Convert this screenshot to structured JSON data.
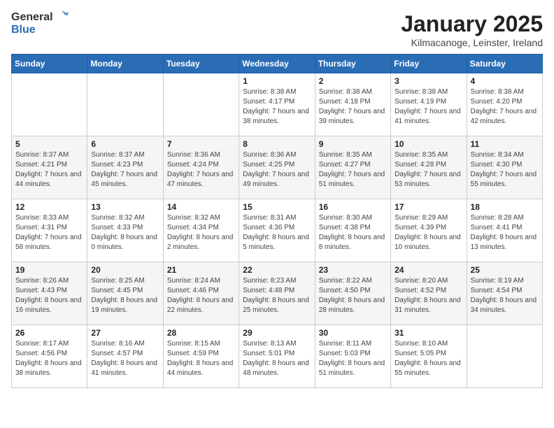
{
  "logo": {
    "general": "General",
    "blue": "Blue"
  },
  "title": "January 2025",
  "location": "Kilmacanoge, Leinster, Ireland",
  "days_of_week": [
    "Sunday",
    "Monday",
    "Tuesday",
    "Wednesday",
    "Thursday",
    "Friday",
    "Saturday"
  ],
  "weeks": [
    [
      {
        "day": "",
        "sunrise": "",
        "sunset": "",
        "daylight": ""
      },
      {
        "day": "",
        "sunrise": "",
        "sunset": "",
        "daylight": ""
      },
      {
        "day": "",
        "sunrise": "",
        "sunset": "",
        "daylight": ""
      },
      {
        "day": "1",
        "sunrise": "Sunrise: 8:38 AM",
        "sunset": "Sunset: 4:17 PM",
        "daylight": "Daylight: 7 hours and 38 minutes."
      },
      {
        "day": "2",
        "sunrise": "Sunrise: 8:38 AM",
        "sunset": "Sunset: 4:18 PM",
        "daylight": "Daylight: 7 hours and 39 minutes."
      },
      {
        "day": "3",
        "sunrise": "Sunrise: 8:38 AM",
        "sunset": "Sunset: 4:19 PM",
        "daylight": "Daylight: 7 hours and 41 minutes."
      },
      {
        "day": "4",
        "sunrise": "Sunrise: 8:38 AM",
        "sunset": "Sunset: 4:20 PM",
        "daylight": "Daylight: 7 hours and 42 minutes."
      }
    ],
    [
      {
        "day": "5",
        "sunrise": "Sunrise: 8:37 AM",
        "sunset": "Sunset: 4:21 PM",
        "daylight": "Daylight: 7 hours and 44 minutes."
      },
      {
        "day": "6",
        "sunrise": "Sunrise: 8:37 AM",
        "sunset": "Sunset: 4:23 PM",
        "daylight": "Daylight: 7 hours and 45 minutes."
      },
      {
        "day": "7",
        "sunrise": "Sunrise: 8:36 AM",
        "sunset": "Sunset: 4:24 PM",
        "daylight": "Daylight: 7 hours and 47 minutes."
      },
      {
        "day": "8",
        "sunrise": "Sunrise: 8:36 AM",
        "sunset": "Sunset: 4:25 PM",
        "daylight": "Daylight: 7 hours and 49 minutes."
      },
      {
        "day": "9",
        "sunrise": "Sunrise: 8:35 AM",
        "sunset": "Sunset: 4:27 PM",
        "daylight": "Daylight: 7 hours and 51 minutes."
      },
      {
        "day": "10",
        "sunrise": "Sunrise: 8:35 AM",
        "sunset": "Sunset: 4:28 PM",
        "daylight": "Daylight: 7 hours and 53 minutes."
      },
      {
        "day": "11",
        "sunrise": "Sunrise: 8:34 AM",
        "sunset": "Sunset: 4:30 PM",
        "daylight": "Daylight: 7 hours and 55 minutes."
      }
    ],
    [
      {
        "day": "12",
        "sunrise": "Sunrise: 8:33 AM",
        "sunset": "Sunset: 4:31 PM",
        "daylight": "Daylight: 7 hours and 58 minutes."
      },
      {
        "day": "13",
        "sunrise": "Sunrise: 8:32 AM",
        "sunset": "Sunset: 4:33 PM",
        "daylight": "Daylight: 8 hours and 0 minutes."
      },
      {
        "day": "14",
        "sunrise": "Sunrise: 8:32 AM",
        "sunset": "Sunset: 4:34 PM",
        "daylight": "Daylight: 8 hours and 2 minutes."
      },
      {
        "day": "15",
        "sunrise": "Sunrise: 8:31 AM",
        "sunset": "Sunset: 4:36 PM",
        "daylight": "Daylight: 8 hours and 5 minutes."
      },
      {
        "day": "16",
        "sunrise": "Sunrise: 8:30 AM",
        "sunset": "Sunset: 4:38 PM",
        "daylight": "Daylight: 8 hours and 8 minutes."
      },
      {
        "day": "17",
        "sunrise": "Sunrise: 8:29 AM",
        "sunset": "Sunset: 4:39 PM",
        "daylight": "Daylight: 8 hours and 10 minutes."
      },
      {
        "day": "18",
        "sunrise": "Sunrise: 8:28 AM",
        "sunset": "Sunset: 4:41 PM",
        "daylight": "Daylight: 8 hours and 13 minutes."
      }
    ],
    [
      {
        "day": "19",
        "sunrise": "Sunrise: 8:26 AM",
        "sunset": "Sunset: 4:43 PM",
        "daylight": "Daylight: 8 hours and 16 minutes."
      },
      {
        "day": "20",
        "sunrise": "Sunrise: 8:25 AM",
        "sunset": "Sunset: 4:45 PM",
        "daylight": "Daylight: 8 hours and 19 minutes."
      },
      {
        "day": "21",
        "sunrise": "Sunrise: 8:24 AM",
        "sunset": "Sunset: 4:46 PM",
        "daylight": "Daylight: 8 hours and 22 minutes."
      },
      {
        "day": "22",
        "sunrise": "Sunrise: 8:23 AM",
        "sunset": "Sunset: 4:48 PM",
        "daylight": "Daylight: 8 hours and 25 minutes."
      },
      {
        "day": "23",
        "sunrise": "Sunrise: 8:22 AM",
        "sunset": "Sunset: 4:50 PM",
        "daylight": "Daylight: 8 hours and 28 minutes."
      },
      {
        "day": "24",
        "sunrise": "Sunrise: 8:20 AM",
        "sunset": "Sunset: 4:52 PM",
        "daylight": "Daylight: 8 hours and 31 minutes."
      },
      {
        "day": "25",
        "sunrise": "Sunrise: 8:19 AM",
        "sunset": "Sunset: 4:54 PM",
        "daylight": "Daylight: 8 hours and 34 minutes."
      }
    ],
    [
      {
        "day": "26",
        "sunrise": "Sunrise: 8:17 AM",
        "sunset": "Sunset: 4:56 PM",
        "daylight": "Daylight: 8 hours and 38 minutes."
      },
      {
        "day": "27",
        "sunrise": "Sunrise: 8:16 AM",
        "sunset": "Sunset: 4:57 PM",
        "daylight": "Daylight: 8 hours and 41 minutes."
      },
      {
        "day": "28",
        "sunrise": "Sunrise: 8:15 AM",
        "sunset": "Sunset: 4:59 PM",
        "daylight": "Daylight: 8 hours and 44 minutes."
      },
      {
        "day": "29",
        "sunrise": "Sunrise: 8:13 AM",
        "sunset": "Sunset: 5:01 PM",
        "daylight": "Daylight: 8 hours and 48 minutes."
      },
      {
        "day": "30",
        "sunrise": "Sunrise: 8:11 AM",
        "sunset": "Sunset: 5:03 PM",
        "daylight": "Daylight: 8 hours and 51 minutes."
      },
      {
        "day": "31",
        "sunrise": "Sunrise: 8:10 AM",
        "sunset": "Sunset: 5:05 PM",
        "daylight": "Daylight: 8 hours and 55 minutes."
      },
      {
        "day": "",
        "sunrise": "",
        "sunset": "",
        "daylight": ""
      }
    ]
  ]
}
